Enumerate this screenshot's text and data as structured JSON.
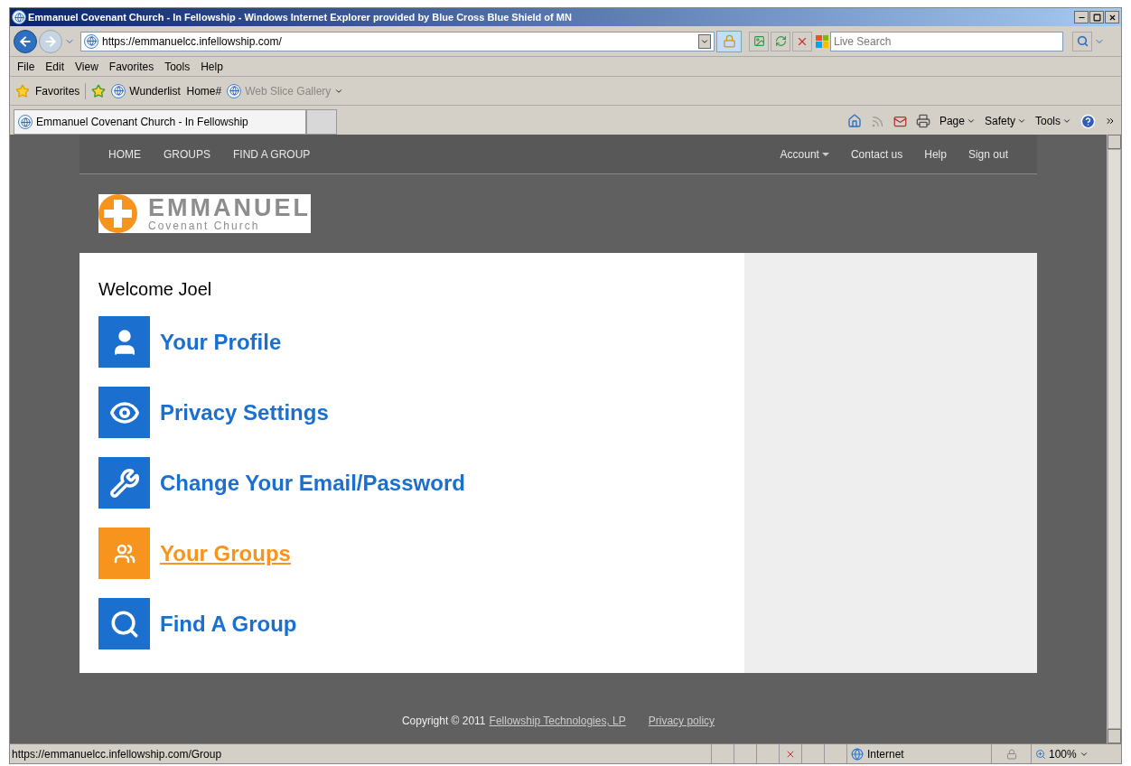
{
  "window": {
    "title": "Emmanuel Covenant Church - In Fellowship - Windows Internet Explorer provided by Blue Cross Blue Shield of MN"
  },
  "address": {
    "value": "https://emmanuelcc.infellowship.com/"
  },
  "search": {
    "placeholder": "Live Search"
  },
  "menu": [
    {
      "label": "File"
    },
    {
      "label": "Edit"
    },
    {
      "label": "View"
    },
    {
      "label": "Favorites"
    },
    {
      "label": "Tools"
    },
    {
      "label": "Help"
    }
  ],
  "favorites_bar": {
    "label": "Favorites",
    "items": [
      {
        "label": "Wunderlist  Home#",
        "disabled": false
      },
      {
        "label": "Web Slice Gallery",
        "disabled": true
      }
    ]
  },
  "tab": {
    "title": "Emmanuel Covenant Church - In Fellowship"
  },
  "command_bar": [
    {
      "label": "Page"
    },
    {
      "label": "Safety"
    },
    {
      "label": "Tools"
    }
  ],
  "site_nav": {
    "left": [
      {
        "label": "HOME"
      },
      {
        "label": "GROUPS"
      },
      {
        "label": "FIND A GROUP"
      }
    ],
    "right": [
      {
        "label": "Account",
        "dropdown": true
      },
      {
        "label": "Contact us",
        "dropdown": false
      },
      {
        "label": "Help",
        "dropdown": false
      },
      {
        "label": "Sign out",
        "dropdown": false
      }
    ]
  },
  "logo": {
    "name": "EMMANUEL",
    "subtitle": "Covenant Church"
  },
  "welcome": "Welcome Joel",
  "links": [
    {
      "kind": "profile",
      "label": "Your Profile",
      "hovered": false
    },
    {
      "kind": "privacy",
      "label": "Privacy Settings",
      "hovered": false
    },
    {
      "kind": "tools",
      "label": "Change Your Email/Password",
      "hovered": false
    },
    {
      "kind": "groups",
      "label": "Your Groups",
      "hovered": true
    },
    {
      "kind": "search",
      "label": "Find A Group",
      "hovered": false
    }
  ],
  "footer": {
    "copyright": "Copyright © 2011",
    "company_link": "Fellowship Technologies, LP",
    "privacy_link": "Privacy policy"
  },
  "status_bar": {
    "url": "https://emmanuelcc.infellowship.com/Group",
    "zone": "Internet",
    "zoom": "100%"
  }
}
